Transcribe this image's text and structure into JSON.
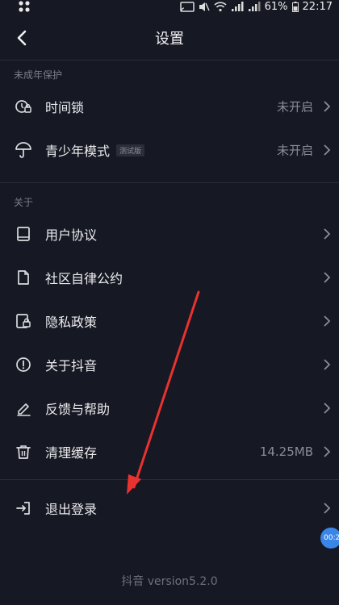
{
  "status_bar": {
    "battery": "61%",
    "time": "22:17"
  },
  "header": {
    "title": "设置"
  },
  "sections": {
    "minor": {
      "label": "未成年保护"
    },
    "about": {
      "label": "关于"
    }
  },
  "rows": {
    "time_lock": {
      "label": "时间锁",
      "value": "未开启"
    },
    "teen_mode": {
      "label": "青少年模式",
      "tag": "测试版",
      "value": "未开启"
    },
    "user_agreement": {
      "label": "用户协议"
    },
    "community": {
      "label": "社区自律公约"
    },
    "privacy": {
      "label": "隐私政策"
    },
    "about_douyin": {
      "label": "关于抖音"
    },
    "feedback": {
      "label": "反馈与帮助"
    },
    "clear_cache": {
      "label": "清理缓存",
      "value": "14.25MB"
    },
    "logout": {
      "label": "退出登录"
    }
  },
  "footer": {
    "version": "抖音 version5.2.0"
  },
  "floating": {
    "text": "00:2"
  },
  "colors": {
    "background": "#161823",
    "annotation_arrow": "#e8322f",
    "bubble": "#3a86e8"
  }
}
